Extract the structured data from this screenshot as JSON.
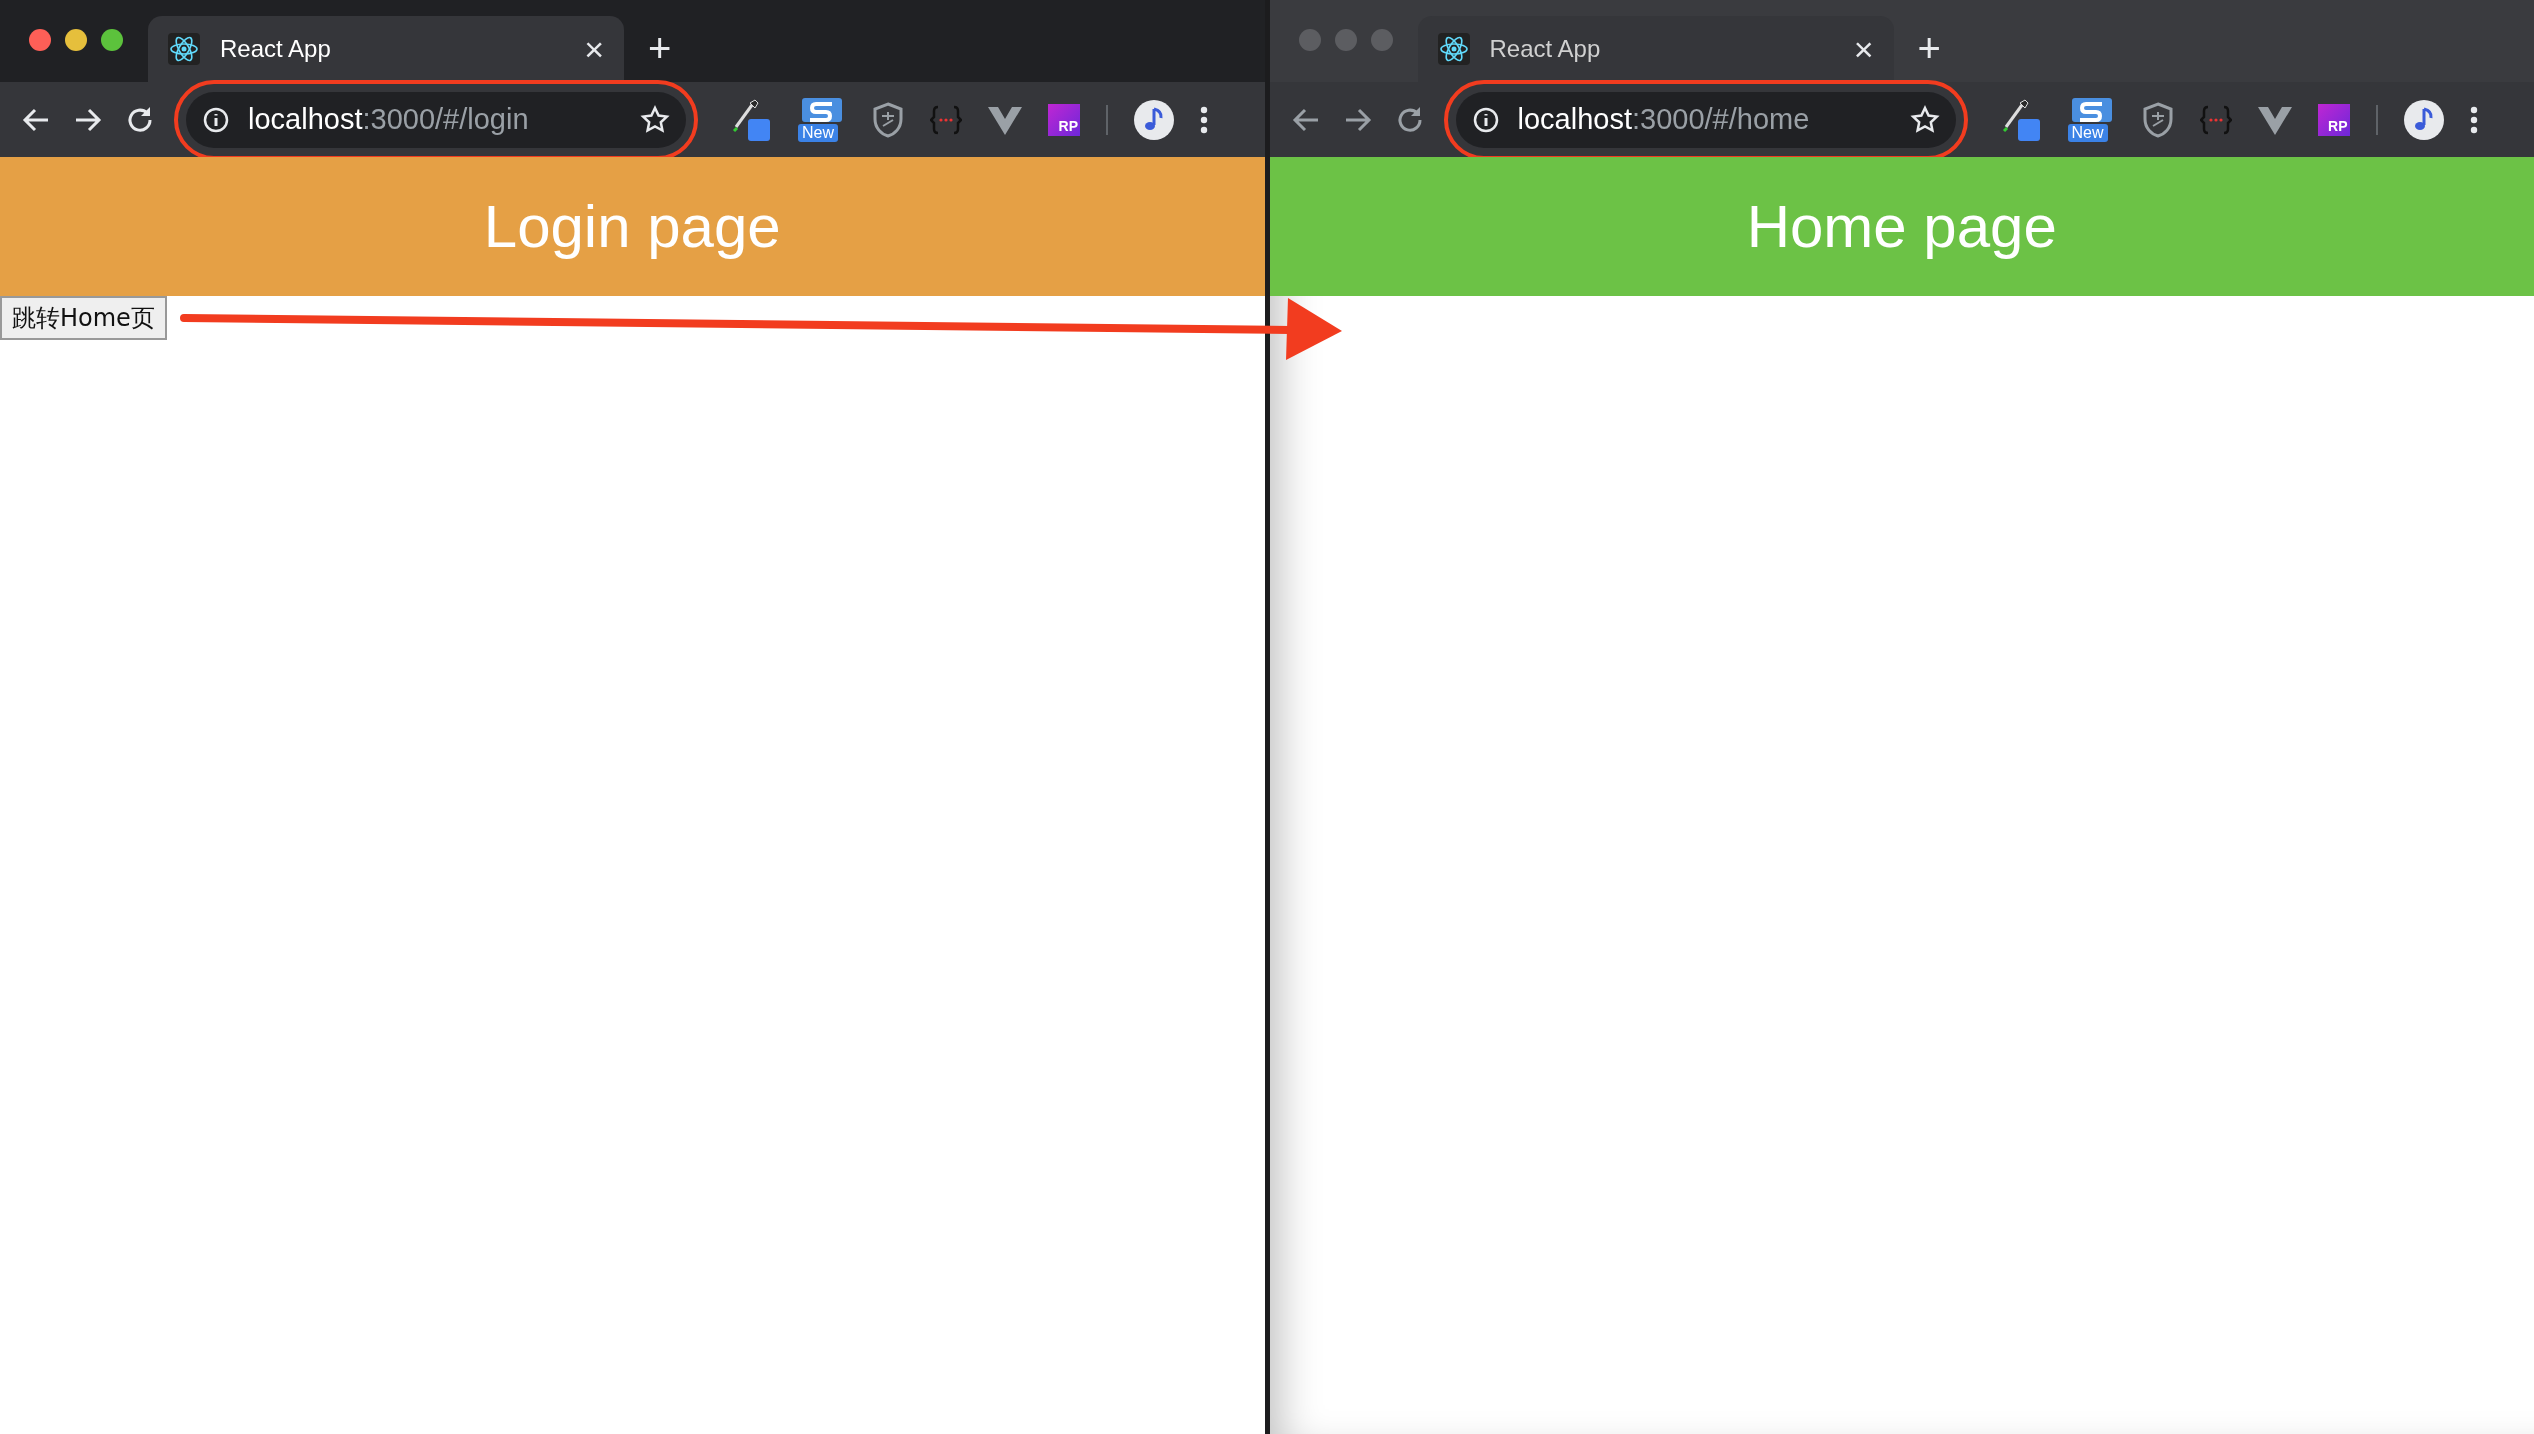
{
  "windows": [
    {
      "active": true,
      "tab": {
        "title": "React App",
        "close": "×"
      },
      "new_tab": "+",
      "address": {
        "host": "localhost",
        "rest": ":3000/#/login",
        "highlighted": true
      },
      "extensions": {
        "new_badge": "New",
        "rp_label": "RP"
      },
      "page": {
        "heading": "Login page",
        "color": "#e5a045",
        "button": "跳转Home页"
      }
    },
    {
      "active": false,
      "tab": {
        "title": "React App",
        "close": "×"
      },
      "new_tab": "+",
      "address": {
        "host": "localhost",
        "rest": ":3000/#/home",
        "highlighted": true
      },
      "extensions": {
        "new_badge": "New",
        "rp_label": "RP"
      },
      "page": {
        "heading": "Home page",
        "color": "#6cc246"
      }
    }
  ],
  "arrow_shown": true
}
